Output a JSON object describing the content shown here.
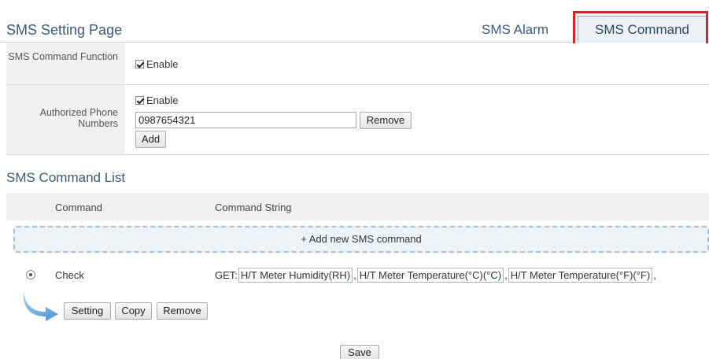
{
  "header": {
    "title": "SMS Setting Page",
    "tabs": [
      {
        "label": "SMS Alarm",
        "active": false
      },
      {
        "label": "SMS Command",
        "active": true
      }
    ]
  },
  "settings": {
    "command_function": {
      "label": "SMS Command Function",
      "checkbox_label": "Enable",
      "checked": true
    },
    "authorized_phone": {
      "label": "Authorized Phone Numbers",
      "checkbox_label": "Enable",
      "checked": true,
      "phone_value": "0987654321",
      "remove_label": "Remove",
      "add_label": "Add"
    }
  },
  "command_list": {
    "title": "SMS Command List",
    "columns": [
      "Command",
      "Command String"
    ],
    "add_label": "+ Add new SMS command",
    "rows": [
      {
        "command": "Check",
        "selected": true,
        "prefix": "GET:",
        "tags": [
          "H/T Meter Humidity(RH)",
          "H/T Meter Temperature(°C)(°C)",
          "H/T Meter Temperature(°F)(°F)"
        ],
        "separator": ","
      }
    ],
    "actions": {
      "setting": "Setting",
      "copy": "Copy",
      "remove": "Remove"
    }
  },
  "footer": {
    "save_label": "Save"
  },
  "colors": {
    "accent": "#3d5a78",
    "highlight_border": "#d6262b",
    "dashed_border": "#a6bfd8"
  }
}
